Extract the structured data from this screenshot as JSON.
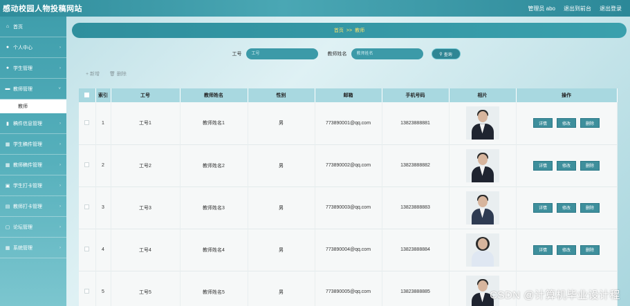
{
  "header": {
    "title": "感动校园人物投稿网站",
    "nav": [
      "管理员 abo",
      "退出到前台",
      "退出登录"
    ]
  },
  "sidebar": {
    "items": [
      {
        "label": "首页",
        "icon": "home-icon",
        "glyph": "⌂"
      },
      {
        "label": "个人中心",
        "icon": "user-icon",
        "glyph": "●"
      },
      {
        "label": "学生管理",
        "icon": "user-icon",
        "glyph": "●"
      },
      {
        "label": "教师管理",
        "icon": "card-icon",
        "glyph": "▬"
      },
      {
        "label": "稿件信息管理",
        "icon": "chart-icon",
        "glyph": "▮"
      },
      {
        "label": "学生稿件管理",
        "icon": "grid-icon",
        "glyph": "▦"
      },
      {
        "label": "教师稿件管理",
        "icon": "grid-icon",
        "glyph": "▦"
      },
      {
        "label": "学生打卡管理",
        "icon": "image-icon",
        "glyph": "▣"
      },
      {
        "label": "教师打卡管理",
        "icon": "list-icon",
        "glyph": "▤"
      },
      {
        "label": "论坛管理",
        "icon": "doc-icon",
        "glyph": "▢"
      },
      {
        "label": "系统管理",
        "icon": "grid-icon",
        "glyph": "▦"
      }
    ],
    "active_sub": "教师"
  },
  "breadcrumb": {
    "home": "首页",
    "sep": ">>",
    "current": "教师"
  },
  "search": {
    "field1_label": "工号",
    "field1_placeholder": "工号",
    "field2_label": "教师姓名",
    "field2_placeholder": "教师姓名",
    "button": "查询"
  },
  "actions": {
    "add": "+ 新增",
    "delete": "删除"
  },
  "table": {
    "headers": [
      "索引",
      "工号",
      "教师姓名",
      "性别",
      "邮箱",
      "手机号码",
      "相片",
      "操作"
    ],
    "rows": [
      {
        "idx": "1",
        "id": "工号1",
        "name": "教师姓名1",
        "gender": "男",
        "email": "773890001@qq.com",
        "phone": "13823888881"
      },
      {
        "idx": "2",
        "id": "工号2",
        "name": "教师姓名2",
        "gender": "男",
        "email": "773890002@qq.com",
        "phone": "13823888882"
      },
      {
        "idx": "3",
        "id": "工号3",
        "name": "教师姓名3",
        "gender": "男",
        "email": "773890003@qq.com",
        "phone": "13823888883"
      },
      {
        "idx": "4",
        "id": "工号4",
        "name": "教师姓名4",
        "gender": "男",
        "email": "773890004@qq.com",
        "phone": "13823888884"
      },
      {
        "idx": "5",
        "id": "工号5",
        "name": "教师姓名5",
        "gender": "男",
        "email": "773890005@qq.com",
        "phone": "13823888885"
      }
    ],
    "op_buttons": {
      "detail": "详情",
      "edit": "修改",
      "delete": "删除"
    }
  },
  "watermark": "CSDN @计算机毕业设计程"
}
